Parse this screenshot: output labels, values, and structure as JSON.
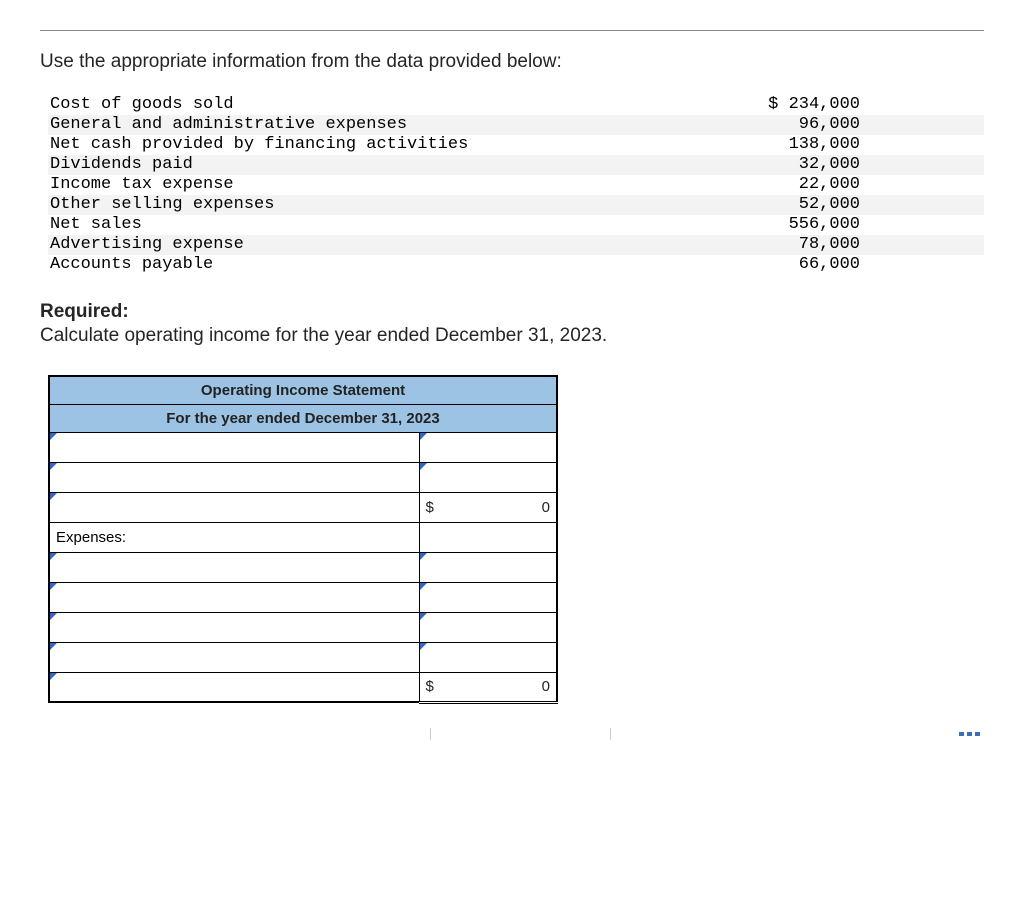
{
  "intro": "Use the appropriate information from the data provided below:",
  "data_rows": [
    {
      "label": "Cost of goods sold",
      "amount": "$ 234,000",
      "alt": false
    },
    {
      "label": "General and administrative expenses",
      "amount": "96,000",
      "alt": true
    },
    {
      "label": "Net cash provided by financing activities",
      "amount": "138,000",
      "alt": false
    },
    {
      "label": "Dividends paid",
      "amount": "32,000",
      "alt": true
    },
    {
      "label": "Income tax expense",
      "amount": "22,000",
      "alt": false
    },
    {
      "label": "Other selling expenses",
      "amount": "52,000",
      "alt": true
    },
    {
      "label": "Net sales",
      "amount": "556,000",
      "alt": false
    },
    {
      "label": "Advertising expense",
      "amount": "78,000",
      "alt": true
    },
    {
      "label": "Accounts payable",
      "amount": "66,000",
      "alt": false
    }
  ],
  "required_label": "Required:",
  "required_text": "Calculate operating income for the year ended December 31, 2023.",
  "stmt": {
    "title": "Operating Income Statement",
    "subtitle": "For the year ended December 31, 2023",
    "expenses_label": "Expenses:",
    "gross_prefix": "$",
    "gross_value": "0",
    "total_prefix": "$",
    "total_value": "0"
  }
}
